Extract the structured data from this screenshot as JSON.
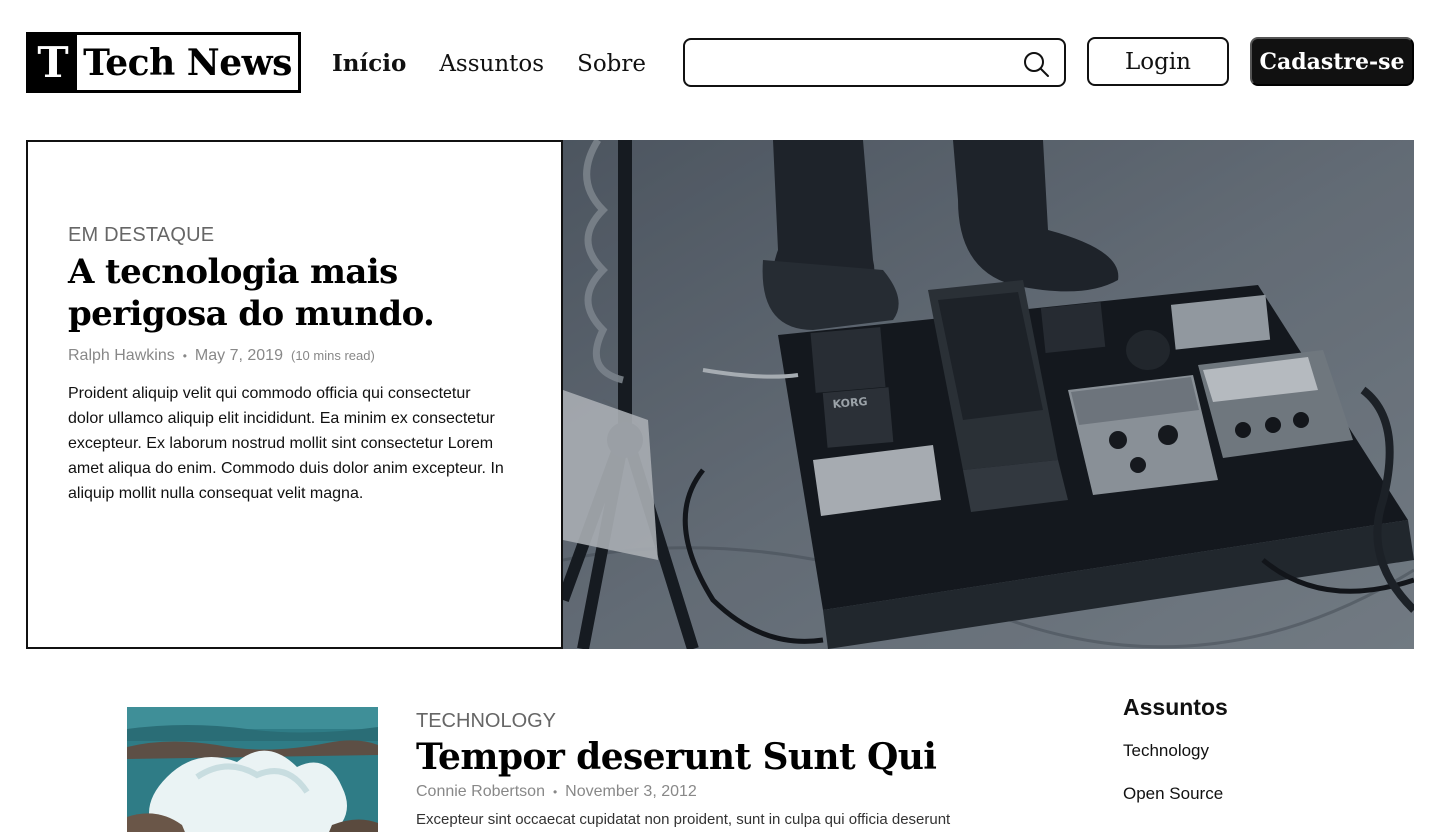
{
  "header": {
    "logo_mark": "T",
    "logo_text": "Tech News",
    "nav": [
      {
        "label": "Início",
        "active": true
      },
      {
        "label": "Assuntos",
        "active": false
      },
      {
        "label": "Sobre",
        "active": false
      }
    ],
    "search": {
      "placeholder": "",
      "value": ""
    },
    "login_label": "Login",
    "signup_label": "Cadastre-se"
  },
  "featured": {
    "eyebrow": "EM DESTAQUE",
    "title": "A tecnologia mais perigosa do mundo.",
    "author": "Ralph Hawkins",
    "separator": "•",
    "date": "May 7, 2019",
    "read_time": "(10 mins read)",
    "excerpt": "Proident aliquip velit qui commodo officia qui consectetur dolor ullamco aliquip elit incididunt. Ea minim ex consectetur excepteur. Ex laborum nostrud mollit sint consectetur Lorem amet aliqua do enim. Commodo duis dolor anim excepteur. In aliquip mollit nulla consequat velit magna."
  },
  "articles": [
    {
      "eyebrow": "TECHNOLOGY",
      "title": "Tempor deserunt Sunt Qui",
      "author": "Connie Robertson",
      "separator": "•",
      "date": "November 3, 2012",
      "excerpt": "Excepteur sint occaecat cupidatat non proident, sunt in culpa qui officia deserunt"
    }
  ],
  "sidebar": {
    "title": "Assuntos",
    "items": [
      "Technology",
      "Open Source"
    ]
  },
  "colors": {
    "text": "#111111",
    "muted": "#888888",
    "eyebrow": "#666666",
    "button_dark": "#111111",
    "background": "#ffffff"
  },
  "icons": {
    "search": "search-icon"
  }
}
